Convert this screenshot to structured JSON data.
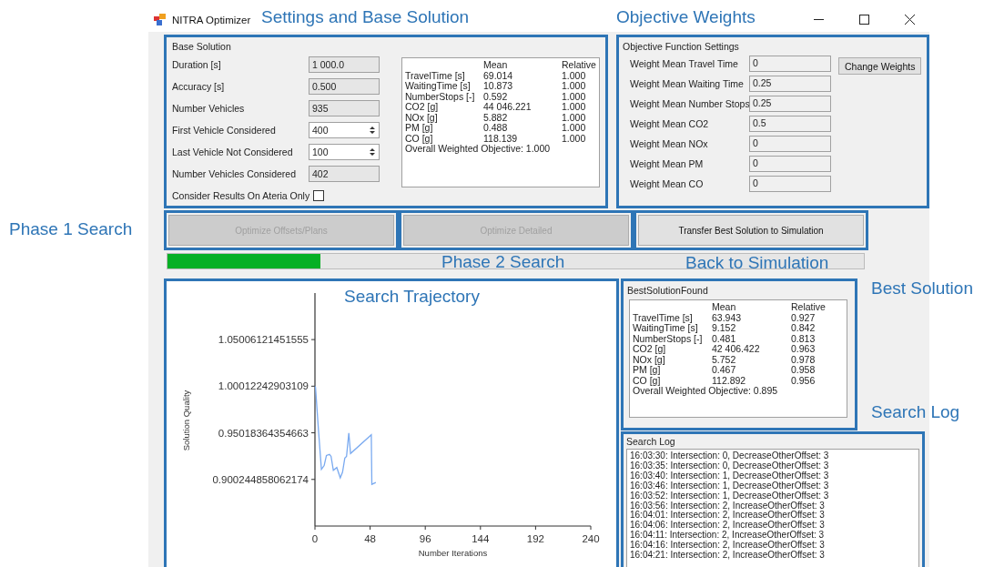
{
  "window": {
    "title": "NITRA Optimizer"
  },
  "base_solution": {
    "annotation": "Settings and Base Solution",
    "title": "Base Solution",
    "fields": [
      {
        "label": "Duration [s]",
        "value": "1 000.0",
        "kind": "readonly"
      },
      {
        "label": "Accuracy [s]",
        "value": "0.500",
        "kind": "readonly"
      },
      {
        "label": "Number Vehicles",
        "value": "935",
        "kind": "readonly"
      },
      {
        "label": "First Vehicle Considered",
        "value": "400",
        "kind": "spinner"
      },
      {
        "label": "Last Vehicle Not Considered",
        "value": "100",
        "kind": "spinner"
      },
      {
        "label": "Number Vehicles Considered",
        "value": "402",
        "kind": "readonly"
      }
    ],
    "checkbox": {
      "label": "Consider Results On Ateria Only",
      "checked": false
    },
    "results": {
      "columns": [
        "Mean",
        "Relative"
      ],
      "rows": [
        {
          "name": "TravelTime [s]",
          "mean": "69.014",
          "relative": "1.000"
        },
        {
          "name": "WaitingTime [s]",
          "mean": "10.873",
          "relative": "1.000"
        },
        {
          "name": "NumberStops [-]",
          "mean": "0.592",
          "relative": "1.000"
        },
        {
          "name": "CO2 [g]",
          "mean": "44 046.221",
          "relative": "1.000"
        },
        {
          "name": "NOx [g]",
          "mean": "5.882",
          "relative": "1.000"
        },
        {
          "name": "PM [g]",
          "mean": "0.488",
          "relative": "1.000"
        },
        {
          "name": "CO [g]",
          "mean": "118.139",
          "relative": "1.000"
        }
      ],
      "overall": "Overall Weighted Objective: 1.000"
    }
  },
  "objective": {
    "annotation": "Objective Weights",
    "title": "Objective Function Settings",
    "button": "Change Weights",
    "weights": [
      {
        "label": "Weight Mean Travel Time",
        "value": "0"
      },
      {
        "label": "Weight Mean Waiting Time",
        "value": "0.25"
      },
      {
        "label": "Weight Mean Number Stops",
        "value": "0.25"
      },
      {
        "label": "Weight Mean  CO2",
        "value": "0.5"
      },
      {
        "label": "Weight Mean NOx",
        "value": "0"
      },
      {
        "label": "Weight Mean PM",
        "value": "0"
      },
      {
        "label": "Weight Mean CO",
        "value": "0"
      }
    ]
  },
  "actions": [
    {
      "label": "Optimize Offsets/Plans",
      "disabled": true,
      "annotation": "Phase 1 Search"
    },
    {
      "label": "Optimize Detailed",
      "disabled": true,
      "annotation": "Phase 2 Search"
    },
    {
      "label": "Transfer Best Solution to Simulation",
      "disabled": false,
      "annotation": "Back to Simulation"
    }
  ],
  "progress": {
    "level": 0.22
  },
  "trajectory": {
    "annotation": "Search Trajectory",
    "chart_data": {
      "type": "line",
      "xlabel": "Number Iterations",
      "ylabel": "Solution Quality",
      "x": [
        0,
        0.5,
        3,
        5.6,
        8,
        10,
        12.7,
        14,
        16,
        19,
        22,
        24,
        26,
        27.5,
        29.5,
        31,
        49,
        49.5,
        53
      ],
      "series": [
        {
          "color": "#7aaaf0",
          "values": [
            1.0,
            0.999,
            0.954,
            0.911,
            0.915,
            0.926,
            0.927,
            0.925,
            0.91,
            0.913,
            0.902,
            0.908,
            0.923,
            0.925,
            0.95,
            0.928,
            0.948,
            0.895,
            0.897
          ]
        }
      ],
      "xlim": [
        0,
        240
      ],
      "ylim": [
        0.8503,
        1.0999
      ],
      "xticks": [
        0,
        48,
        96,
        144,
        192,
        240
      ],
      "yticks": [
        {
          "value": 0.900244858062174,
          "label": "0.900244858062174"
        },
        {
          "value": 0.95018364354663,
          "label": "0.95018364354663"
        },
        {
          "value": 1.00012242903109,
          "label": "1.00012242903109"
        },
        {
          "value": 1.05006121451555,
          "label": "1.05006121451555"
        }
      ]
    }
  },
  "best_solution": {
    "annotation": "Best Solution",
    "title": "BestSolutionFound",
    "results": {
      "columns": [
        "Mean",
        "Relative"
      ],
      "rows": [
        {
          "name": "TravelTime [s]",
          "mean": "63.943",
          "relative": "0.927"
        },
        {
          "name": "WaitingTime [s]",
          "mean": "9.152",
          "relative": "0.842"
        },
        {
          "name": "NumberStops [-]",
          "mean": "0.481",
          "relative": "0.813"
        },
        {
          "name": "CO2 [g]",
          "mean": "42 406.422",
          "relative": "0.963"
        },
        {
          "name": "NOx [g]",
          "mean": "5.752",
          "relative": "0.978"
        },
        {
          "name": "PM [g]",
          "mean": "0.467",
          "relative": "0.958"
        },
        {
          "name": "CO [g]",
          "mean": "112.892",
          "relative": "0.956"
        }
      ],
      "overall": "Overall Weighted Objective: 0.895"
    }
  },
  "search_log": {
    "annotation": "Search Log",
    "title": "Search Log",
    "lines": [
      "16:03:30: Intersection: 0, DecreaseOtherOffset: 3",
      "16:03:35: Intersection: 0, DecreaseOtherOffset: 3",
      "16:03:40: Intersection: 1, DecreaseOtherOffset: 3",
      "16:03:46: Intersection: 1, DecreaseOtherOffset: 3",
      "16:03:52: Intersection: 1, DecreaseOtherOffset: 3",
      "16:03:56: Intersection: 2, IncreaseOtherOffset: 3",
      "16:04:01: Intersection: 2, IncreaseOtherOffset: 3",
      "16:04:06: Intersection: 2, IncreaseOtherOffset: 3",
      "16:04:11: Intersection: 2, IncreaseOtherOffset: 3",
      "16:04:16: Intersection: 2, IncreaseOtherOffset: 3",
      "16:04:21: Intersection: 2, IncreaseOtherOffset: 3"
    ]
  }
}
